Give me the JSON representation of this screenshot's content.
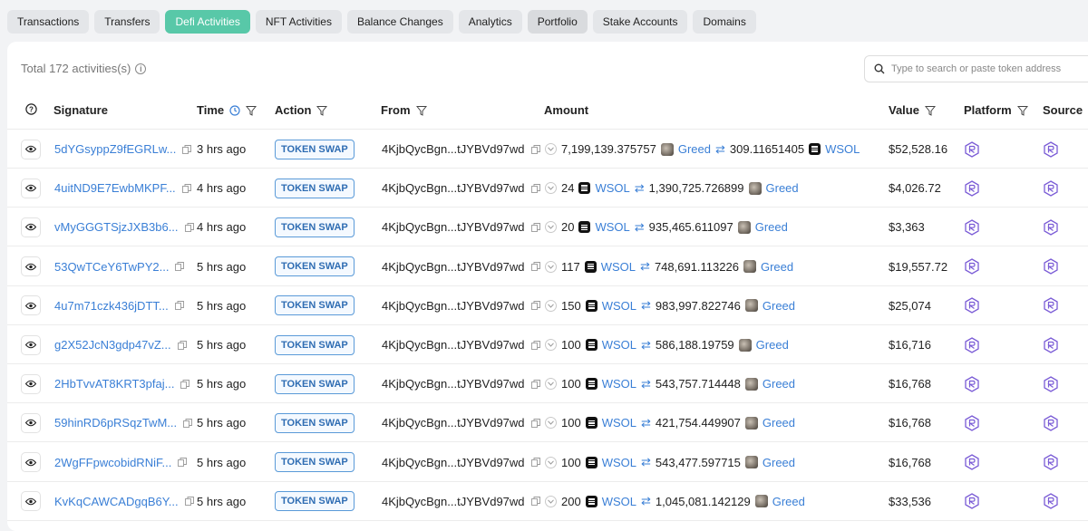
{
  "tabs": [
    "Transactions",
    "Transfers",
    "Defi Activities",
    "NFT Activities",
    "Balance Changes",
    "Analytics",
    "Portfolio",
    "Stake Accounts",
    "Domains"
  ],
  "total_text": "Total 172 activities(s)",
  "search_placeholder": "Type to search or paste token address",
  "columns": {
    "signature": "Signature",
    "time": "Time",
    "action": "Action",
    "from": "From",
    "amount": "Amount",
    "value": "Value",
    "platform": "Platform",
    "source": "Source"
  },
  "rows": [
    {
      "sig": "5dYGsyppZ9fEGRLw...",
      "time": "3 hrs ago",
      "action": "TOKEN SWAP",
      "from": "4KjbQycBgn...tJYBVd97wd",
      "amt1": "7,199,139.375757",
      "tok1": "Greed",
      "amt2": "309.11651405",
      "tok2": "WSOL",
      "value": "$52,528.16"
    },
    {
      "sig": "4uitND9E7EwbMKPF...",
      "time": "4 hrs ago",
      "action": "TOKEN SWAP",
      "from": "4KjbQycBgn...tJYBVd97wd",
      "amt1": "24",
      "tok1": "WSOL",
      "amt2": "1,390,725.726899",
      "tok2": "Greed",
      "value": "$4,026.72"
    },
    {
      "sig": "vMyGGGTSjzJXB3b6...",
      "time": "4 hrs ago",
      "action": "TOKEN SWAP",
      "from": "4KjbQycBgn...tJYBVd97wd",
      "amt1": "20",
      "tok1": "WSOL",
      "amt2": "935,465.611097",
      "tok2": "Greed",
      "value": "$3,363"
    },
    {
      "sig": "53QwTCeY6TwPY2...",
      "time": "5 hrs ago",
      "action": "TOKEN SWAP",
      "from": "4KjbQycBgn...tJYBVd97wd",
      "amt1": "117",
      "tok1": "WSOL",
      "amt2": "748,691.113226",
      "tok2": "Greed",
      "value": "$19,557.72"
    },
    {
      "sig": "4u7m71czk436jDTT...",
      "time": "5 hrs ago",
      "action": "TOKEN SWAP",
      "from": "4KjbQycBgn...tJYBVd97wd",
      "amt1": "150",
      "tok1": "WSOL",
      "amt2": "983,997.822746",
      "tok2": "Greed",
      "value": "$25,074"
    },
    {
      "sig": "g2X52JcN3gdp47vZ...",
      "time": "5 hrs ago",
      "action": "TOKEN SWAP",
      "from": "4KjbQycBgn...tJYBVd97wd",
      "amt1": "100",
      "tok1": "WSOL",
      "amt2": "586,188.19759",
      "tok2": "Greed",
      "value": "$16,716"
    },
    {
      "sig": "2HbTvvAT8KRT3pfaj...",
      "time": "5 hrs ago",
      "action": "TOKEN SWAP",
      "from": "4KjbQycBgn...tJYBVd97wd",
      "amt1": "100",
      "tok1": "WSOL",
      "amt2": "543,757.714448",
      "tok2": "Greed",
      "value": "$16,768"
    },
    {
      "sig": "59hinRD6pRSqzTwM...",
      "time": "5 hrs ago",
      "action": "TOKEN SWAP",
      "from": "4KjbQycBgn...tJYBVd97wd",
      "amt1": "100",
      "tok1": "WSOL",
      "amt2": "421,754.449907",
      "tok2": "Greed",
      "value": "$16,768"
    },
    {
      "sig": "2WgFFpwcobidRNiF...",
      "time": "5 hrs ago",
      "action": "TOKEN SWAP",
      "from": "4KjbQycBgn...tJYBVd97wd",
      "amt1": "100",
      "tok1": "WSOL",
      "amt2": "543,477.597715",
      "tok2": "Greed",
      "value": "$16,768"
    },
    {
      "sig": "KvKqCAWCADgqB6Y...",
      "time": "5 hrs ago",
      "action": "TOKEN SWAP",
      "from": "4KjbQycBgn...tJYBVd97wd",
      "amt1": "200",
      "tok1": "WSOL",
      "amt2": "1,045,081.142129",
      "tok2": "Greed",
      "value": "$33,536"
    }
  ],
  "colors": {
    "active_tab": "#58c8a8",
    "link": "#3a7fd6",
    "badge_border": "#5a9ad8",
    "platform_icon": "#7a5bd6"
  }
}
